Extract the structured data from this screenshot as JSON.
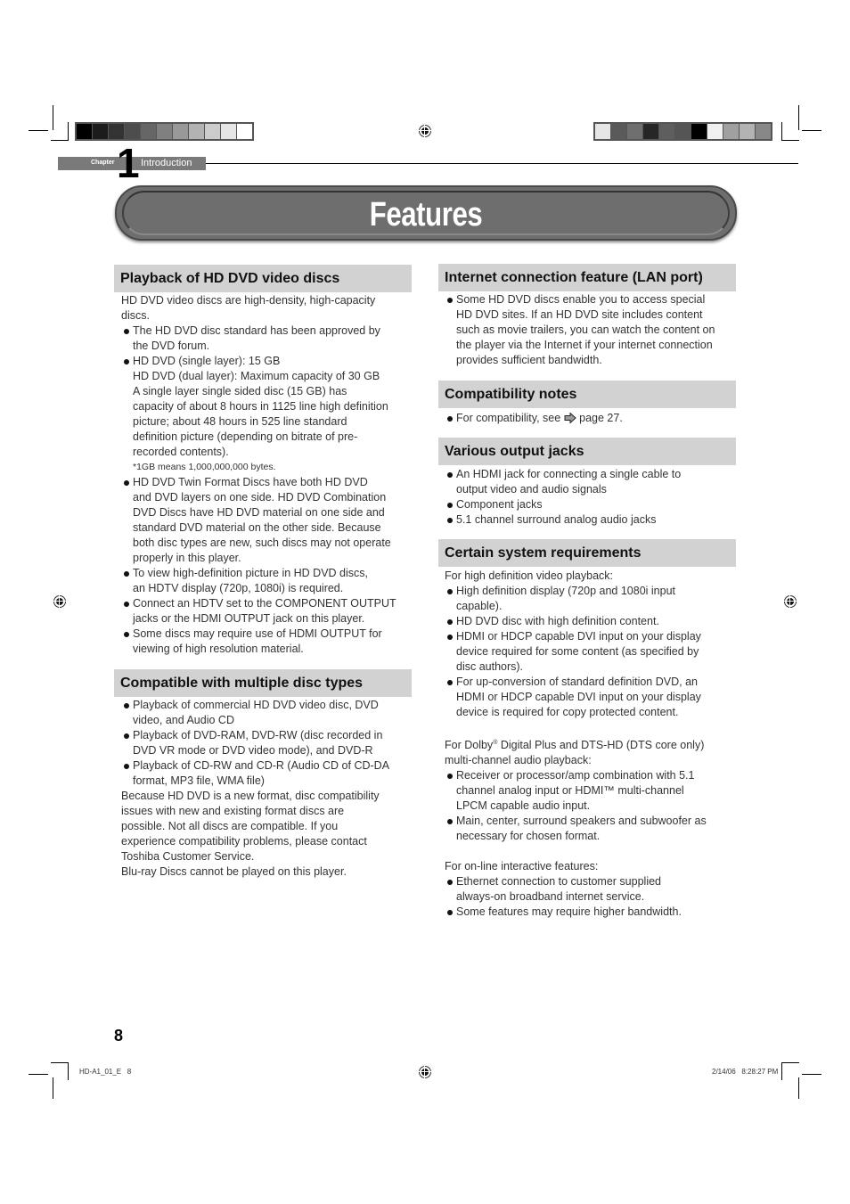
{
  "print_marks": {
    "left_scale_colors": [
      "#000000",
      "#1c1c1c",
      "#333333",
      "#4d4d4d",
      "#666666",
      "#808080",
      "#999999",
      "#b3b3b3",
      "#cccccc",
      "#e6e6e6",
      "#ffffff"
    ],
    "right_scale_colors": [
      "#e6e6e6",
      "#5a5a5a",
      "#6f6f6f",
      "#262626",
      "#5e5e5e",
      "#555555",
      "#000000",
      "#f0f0f0",
      "#a0a0a0",
      "#b3b3b3",
      "#888888"
    ]
  },
  "header": {
    "chapter_label": "Chapter",
    "chapter_number": "1",
    "chapter_title": "Introduction"
  },
  "page_title": "Features",
  "left_column": {
    "playback": {
      "heading": "Playback of HD DVD video discs",
      "intro": [
        "HD DVD video discs are high-density, high-capacity",
        "discs."
      ],
      "bullets": [
        [
          "The HD DVD disc standard has been approved by",
          "the DVD forum."
        ],
        [
          "HD DVD (single layer): 15 GB",
          "HD DVD (dual layer): Maximum capacity of 30 GB",
          "A single layer single sided disc (15 GB) has",
          "capacity of about 8 hours in 1125 line high definition",
          "picture; about 48 hours in 525 line standard",
          "definition picture (depending on bitrate of pre-",
          "recorded contents)."
        ],
        [
          "HD DVD Twin Format Discs have both HD DVD",
          "and DVD layers on one side. HD DVD Combination",
          "DVD Discs have HD DVD material on one side and",
          "standard DVD material on the other side. Because",
          "both disc types are new, such discs may not operate",
          "properly in this player."
        ],
        [
          "To view high-definition picture in HD DVD discs,",
          "an HDTV display (720p, 1080i) is required."
        ],
        [
          "Connect an HDTV set to the COMPONENT OUTPUT",
          "jacks or the HDMI OUTPUT jack on this player."
        ],
        [
          "Some discs may require use of HDMI OUTPUT for",
          "viewing of high resolution material."
        ]
      ],
      "footnote": "*1GB means 1,000,000,000 bytes."
    },
    "compatible": {
      "heading": "Compatible with multiple disc types",
      "bullets": [
        [
          "Playback of commercial HD DVD video disc, DVD",
          "video, and Audio CD"
        ],
        [
          "Playback of DVD-RAM, DVD-RW (disc recorded in",
          "DVD VR mode or DVD video mode), and DVD-R"
        ],
        [
          "Playback of CD-RW and CD-R (Audio CD of CD-DA",
          "format, MP3 file, WMA file)"
        ]
      ],
      "paragraph": [
        "Because HD DVD is a new format, disc compatibility",
        "issues with new and existing format discs are",
        "possible. Not all discs are compatible. If you",
        "experience compatibility problems, please contact",
        "Toshiba Customer Service.",
        "Blu-ray Discs cannot be played on this player."
      ]
    }
  },
  "right_column": {
    "internet": {
      "heading": "Internet connection feature (LAN port)",
      "bullets": [
        [
          "Some HD DVD discs enable you to access special",
          "HD DVD sites. If an HD DVD site includes content",
          "such as movie trailers, you can watch the content on",
          "the player via the Internet if your internet connection",
          "provides sufficient bandwidth."
        ]
      ]
    },
    "compat_notes": {
      "heading": "Compatibility notes",
      "text_before": "For compatibility, see",
      "ref_icon": "page-reference-arrow-icon",
      "text_after": "page 27."
    },
    "output_jacks": {
      "heading": "Various output jacks",
      "bullets": [
        [
          "An HDMI jack for connecting a single cable to",
          "output video and audio signals"
        ],
        [
          "Component jacks"
        ],
        [
          "5.1 channel surround analog audio jacks"
        ]
      ]
    },
    "requirements": {
      "heading": "Certain system requirements",
      "groups": [
        {
          "intro": [
            "For high definition video playback:"
          ],
          "bullets": [
            [
              "High definition display (720p and 1080i input",
              "capable)."
            ],
            [
              "HD DVD disc with high definition content."
            ],
            [
              "HDMI or HDCP capable DVI input on your display",
              "device required for some content (as specified by",
              "disc authors)."
            ],
            [
              "For up-conversion of standard definition DVD, an",
              "HDMI or HDCP capable DVI input on your display",
              "device is required for copy protected content."
            ]
          ]
        },
        {
          "intro": [
            "For Dolby® Digital Plus and DTS-HD (DTS core only)",
            "multi-channel audio playback:"
          ],
          "bullets": [
            [
              "Receiver or processor/amp combination with 5.1",
              "channel analog input or HDMI™ multi-channel",
              "LPCM capable audio input."
            ],
            [
              "Main, center, surround speakers and subwoofer as",
              "necessary for chosen format."
            ]
          ]
        },
        {
          "intro": [
            "For on-line interactive features:"
          ],
          "bullets": [
            [
              "Ethernet connection to customer supplied",
              "always-on broadband internet service."
            ],
            [
              "Some features may require higher bandwidth."
            ]
          ]
        }
      ]
    }
  },
  "footer": {
    "page_number": "8",
    "file_slug": "HD-A1_01_E   8",
    "timestamp": "2/14/06   8:28:27 PM"
  }
}
